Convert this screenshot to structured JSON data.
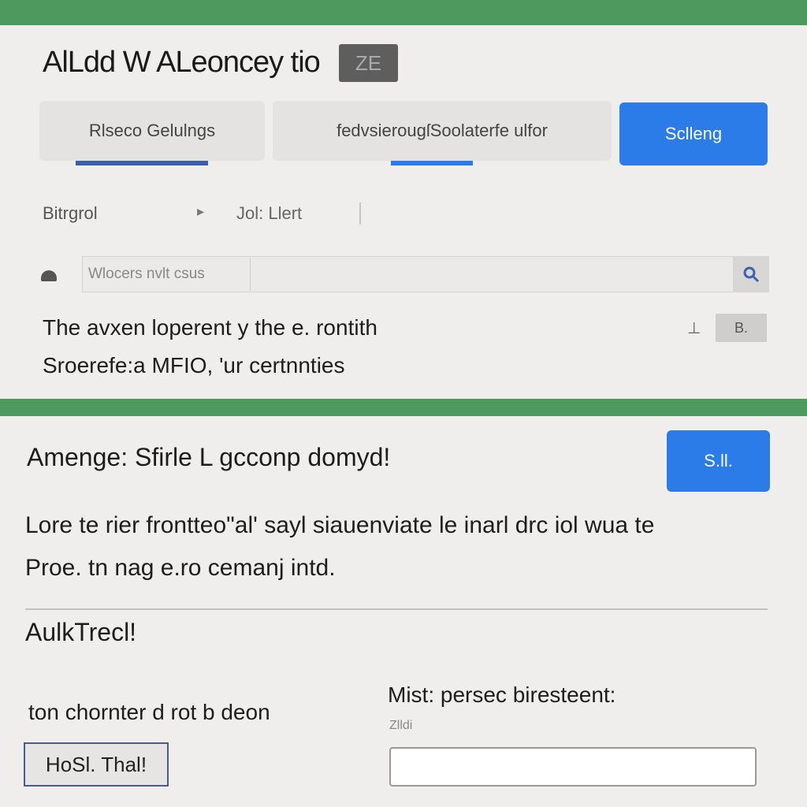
{
  "header": {
    "title": "AlLdd W ALeoncey tio",
    "badge": "ZE"
  },
  "tabs": [
    {
      "label": "Rlseco Gelulngs"
    },
    {
      "label": "fedvsierougſSoolaterfe ulfor"
    }
  ],
  "primary_action": {
    "label": "Sclleng"
  },
  "filters": {
    "left_label": "Bitrgrol",
    "arrow": "▸",
    "right_label": "Jol: Llert"
  },
  "search": {
    "prefix": "Wlocers  nvlt csus",
    "icon": "search-icon"
  },
  "info": {
    "line1": "The avxen loperent y the e. rontith",
    "line2": "Sroerefe:a MFIO, 'ur certnnties",
    "marker": "⊥",
    "small_button": "B."
  },
  "section2": {
    "heading": "Amenge: Sfirle L gcconp domyd!",
    "button": "S.ll.",
    "para1": "Lore te rier frontteo\"al' sayl siauenviate le inarl drc iol wua te",
    "para2": "Proe. tn nag e.ro cemanj intd."
  },
  "section3": {
    "heading": "AulkTrecl!",
    "label_left": "ton chornter d rot b deon",
    "label_right": "Mist: persec biresteent:",
    "hint_right": "Zlldi",
    "outline_button": "HoSl. Thal!",
    "input_value": ""
  },
  "colors": {
    "accent_green": "#4e9a5e",
    "primary_blue": "#2b7be8"
  }
}
